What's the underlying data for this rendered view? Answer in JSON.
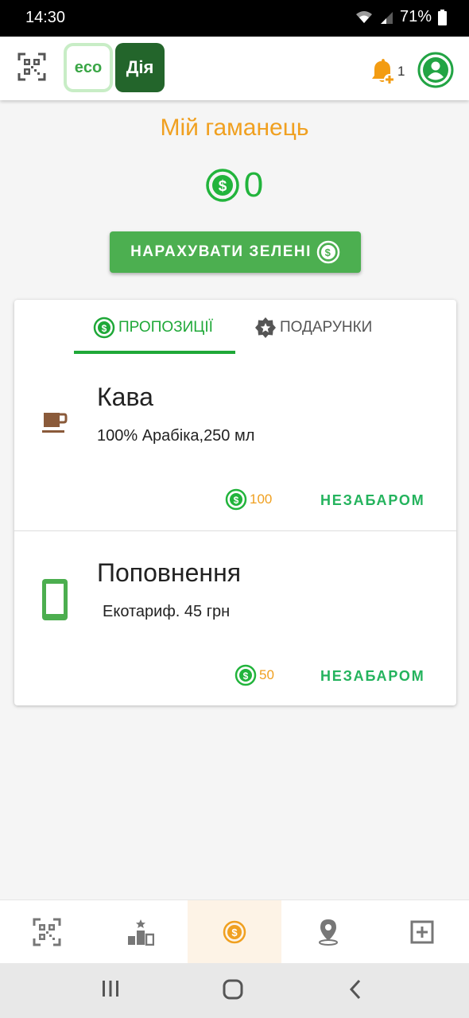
{
  "status_bar": {
    "time": "14:30",
    "battery": "71%"
  },
  "header": {
    "logo_eco": "eco",
    "logo_diia": "Дія",
    "notification_count": "1"
  },
  "wallet": {
    "title": "Мій гаманець",
    "balance": "0",
    "accrue_button": "НАРАХУВАТИ ЗЕЛЕНІ"
  },
  "tabs": [
    {
      "label": "ПРОПОЗИЦІЇ",
      "icon": "coin-icon",
      "active": true
    },
    {
      "label": "ПОДАРУНКИ",
      "icon": "badge-star-icon",
      "active": false
    }
  ],
  "offers": [
    {
      "title": "Кава",
      "description": "100% Арабіка,250 мл",
      "price": "100",
      "status": "НЕЗАБАРОМ",
      "icon": "coffee-icon"
    },
    {
      "title": "Поповнення",
      "description": "Екотариф. 45 грн",
      "price": "50",
      "status": "НЕЗАБАРОМ",
      "icon": "phone-icon"
    }
  ],
  "bottom_nav": [
    {
      "icon": "qr-scan-icon",
      "active": false
    },
    {
      "icon": "leaderboard-icon",
      "active": false
    },
    {
      "icon": "wallet-coin-icon",
      "active": true
    },
    {
      "icon": "map-pin-icon",
      "active": false
    },
    {
      "icon": "add-box-icon",
      "active": false
    }
  ],
  "colors": {
    "accent_green": "#4caf50",
    "coin_green": "#22b43c",
    "orange": "#f0a020",
    "status_green": "#24b35d"
  }
}
